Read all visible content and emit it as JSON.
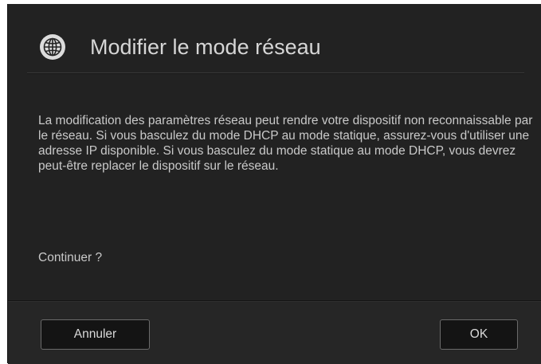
{
  "dialog": {
    "title": "Modifier le mode réseau",
    "title_icon": "globe-icon",
    "message": "La modification des paramètres réseau peut rendre votre dispositif non reconnaissable par le réseau. Si vous basculez du mode DHCP au mode statique, assurez-vous d'utiliser une adresse IP disponible. Si vous basculez du mode statique au mode DHCP, vous devrez peut-être replacer le dispositif sur le réseau.",
    "question": "Continuer ?",
    "cancel_label": "Annuler",
    "ok_label": "OK"
  },
  "colors": {
    "dialog_background": "#222222",
    "text": "#c9c9c9",
    "button_background": "#141414",
    "button_border": "#6a6a6a"
  }
}
